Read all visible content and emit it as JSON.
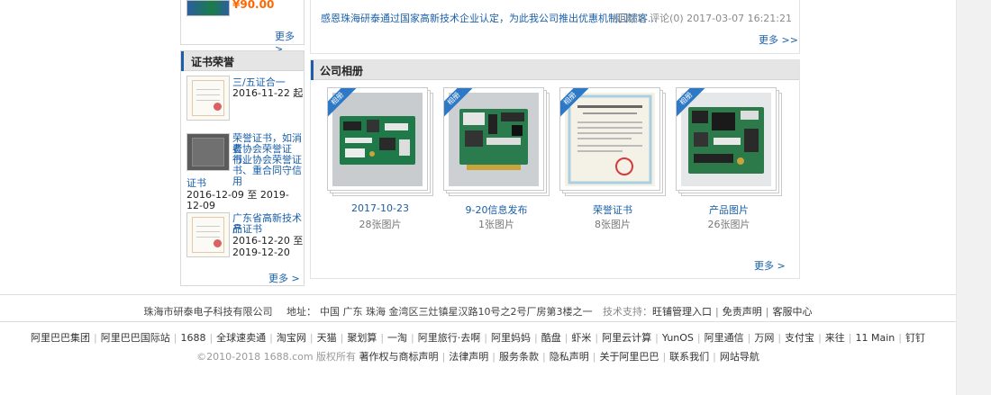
{
  "left_top": {
    "price": "¥90.00",
    "more": "更多 >"
  },
  "cert_section": {
    "title": "证书荣誉",
    "items": [
      {
        "name": "三/五证合一",
        "date": "2016-11-22 起"
      },
      {
        "name_lines": [
          "荣誉证书，如消费",
          "者协会荣誉证书、",
          "行业协会荣誉证",
          "书、重合同守信用",
          "证书"
        ],
        "date": "2016-12-09 至 2019-12-09"
      },
      {
        "name_lines": [
          "广东省高新技术产",
          "品证书"
        ],
        "date_lines": [
          "2016-12-20 至",
          "2019-12-20"
        ]
      }
    ],
    "more": "更多 >"
  },
  "news": {
    "title": "感恩珠海研泰通过国家高新技术企业认定，为此我公司推出优惠机制回馈客...",
    "meta": "阅读(1) 评论(0) 2017-03-07 16:21:21",
    "more": "更多 >>"
  },
  "album_section": {
    "title": "公司相册",
    "ribbon": "相册",
    "albums": [
      {
        "name": "2017-10-23",
        "count": "28张图片",
        "kind": "board-blue"
      },
      {
        "name": "9-20信息发布",
        "count": "1张图片",
        "kind": "board-pcie"
      },
      {
        "name": "荣誉证书",
        "count": "8张图片",
        "kind": "certificate"
      },
      {
        "name": "产品图片",
        "count": "26张图片",
        "kind": "board-green"
      }
    ],
    "more": "更多 >"
  },
  "footer": {
    "company": "珠海市研泰电子科技有限公司",
    "address_label": "地址：",
    "address": "中国 广东 珠海 金湾区三灶镇星汉路10号之2号厂房第3楼之一",
    "support_label": "技术支持：",
    "support_links": [
      "旺铺管理入口",
      "免责声明",
      "客服中心"
    ],
    "links": [
      "阿里巴巴集团",
      "阿里巴巴国际站",
      "1688",
      "全球速卖通",
      "淘宝网",
      "天猫",
      "聚划算",
      "一淘",
      "阿里旅行·去啊",
      "阿里妈妈",
      "酷盘",
      "虾米",
      "阿里云计算",
      "YunOS",
      "阿里通信",
      "万网",
      "支付宝",
      "来往",
      "11 Main",
      "钉钉"
    ],
    "copyright": "©2010-2018 1688.com 版权所有",
    "legal_links": [
      "著作权与商标声明",
      "法律声明",
      "服务条款",
      "隐私声明",
      "关于阿里巴巴",
      "联系我们",
      "网站导航"
    ]
  }
}
